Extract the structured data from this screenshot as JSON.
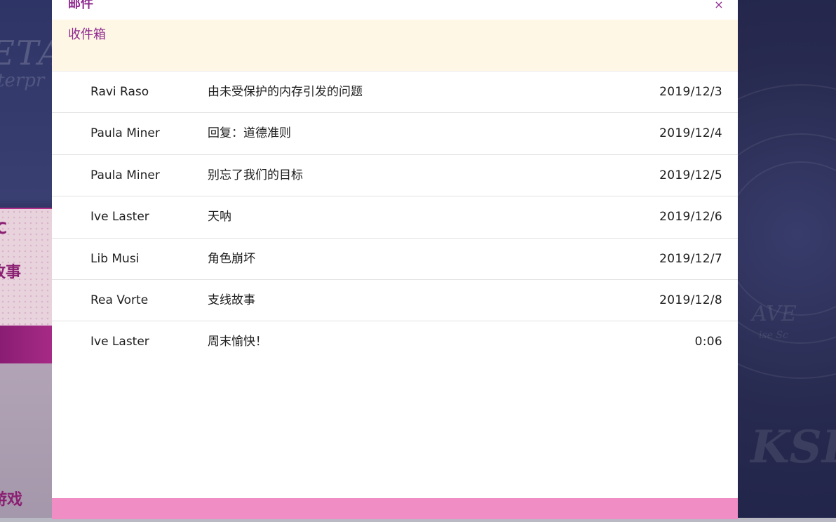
{
  "modal": {
    "title": "邮件",
    "close_label": "×",
    "folder_label": "收件箱"
  },
  "mails": [
    {
      "sender": "Ravi Raso",
      "subject": "由未受保护的内存引发的问题",
      "date": "2019/12/3"
    },
    {
      "sender": "Paula Miner",
      "subject": "回复：道德准则",
      "date": "2019/12/4"
    },
    {
      "sender": "Paula Miner",
      "subject": "别忘了我们的目标",
      "date": "2019/12/5"
    },
    {
      "sender": "Ive Laster",
      "subject": "天呐",
      "date": "2019/12/6"
    },
    {
      "sender": "Lib Musi",
      "subject": "角色崩坏",
      "date": "2019/12/7"
    },
    {
      "sender": "Rea Vorte",
      "subject": "支线故事",
      "date": "2019/12/8"
    },
    {
      "sender": "Ive Laster",
      "subject": "周末愉快！",
      "date": "0:06"
    }
  ],
  "background": {
    "word_large": "ETA",
    "word_small": "terpr",
    "menu_letter": "C",
    "menu_story": "故事",
    "menu_game": "游戏",
    "right_word_1": "AVE",
    "right_word_2": "ise Sc",
    "right_word_3": "KSE"
  },
  "colors": {
    "accent": "#8e2a8f",
    "folder_bar": "#fff7e6",
    "footer": "#f18dc5",
    "backdrop": "#2a2d55"
  }
}
